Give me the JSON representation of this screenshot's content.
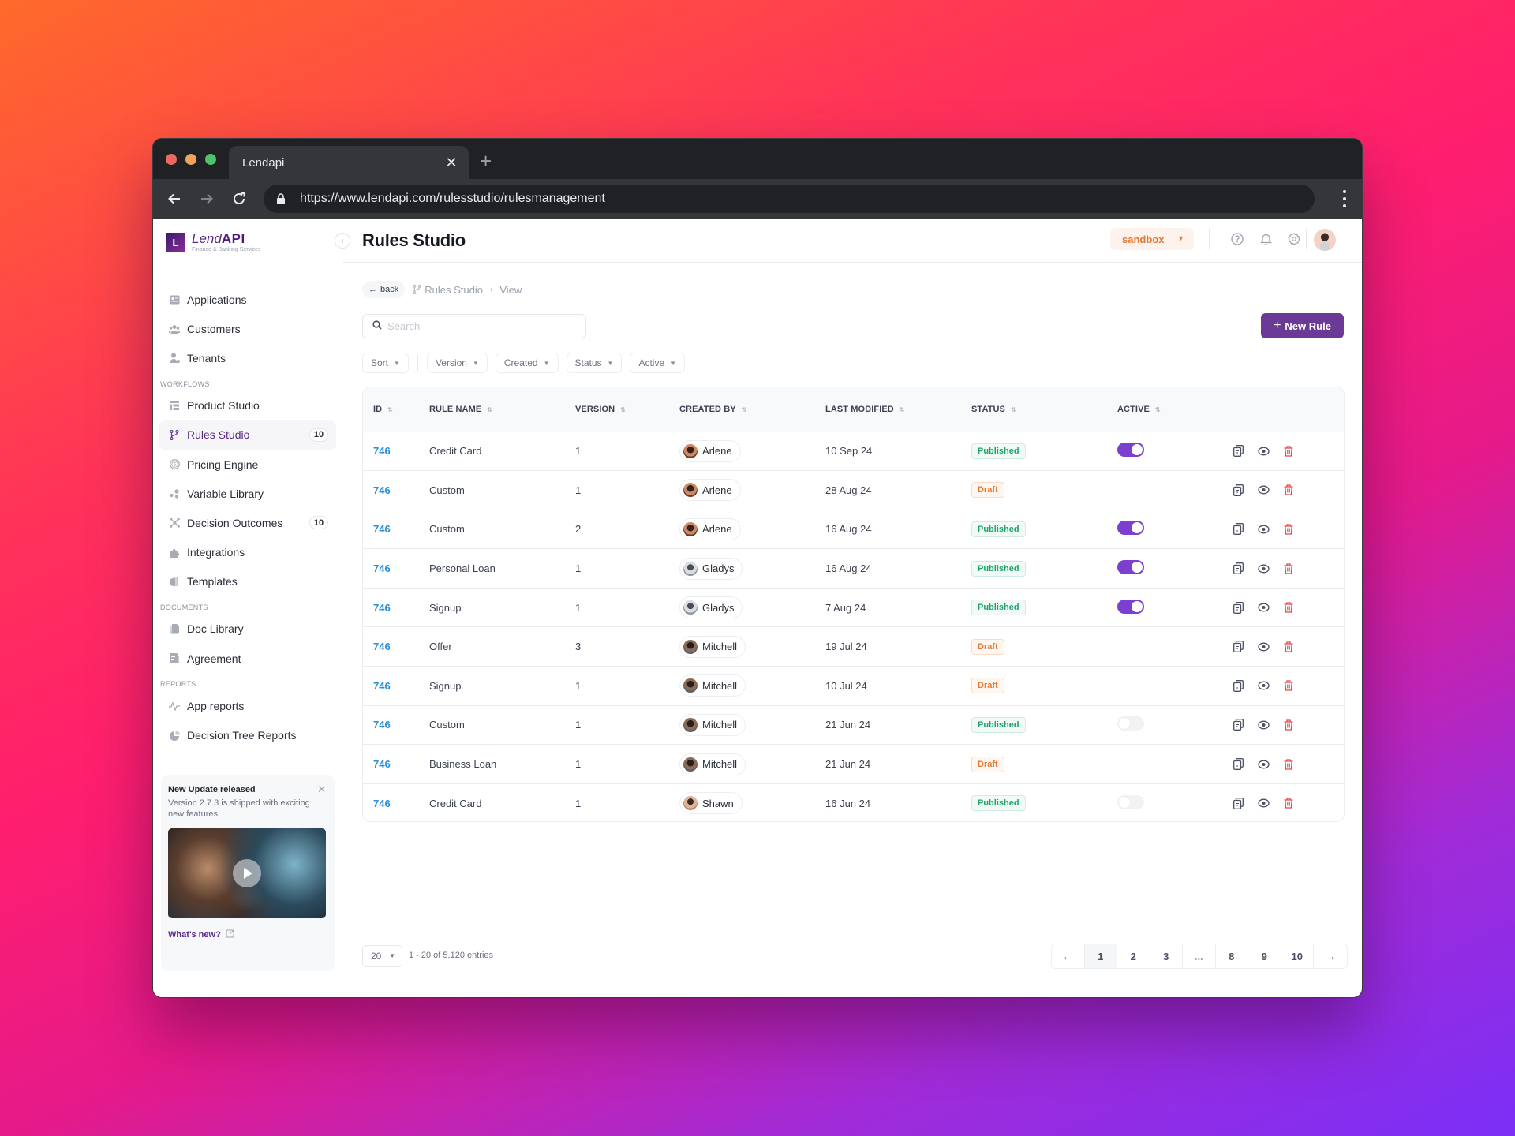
{
  "browser": {
    "tab_title": "Lendapi",
    "url": "https://www.lendapi.com/rulesstudio/rulesmanagement"
  },
  "brand": {
    "logo_letter": "L",
    "name_light": "Lend",
    "name_bold": "API",
    "tagline": "Finance & Banking Services",
    "accent_color": "#6a3a96"
  },
  "sidebar": {
    "items": [
      {
        "label": "Applications",
        "icon": "id-card-icon"
      },
      {
        "label": "Customers",
        "icon": "users-icon"
      },
      {
        "label": "Tenants",
        "icon": "user-star-icon"
      }
    ],
    "sections": [
      {
        "title": "WORKFLOWS",
        "items": [
          {
            "label": "Product Studio",
            "icon": "grid-icon"
          },
          {
            "label": "Rules Studio",
            "icon": "branch-icon",
            "badge": "10",
            "active": true
          },
          {
            "label": "Pricing Engine",
            "icon": "dollar-circle-icon"
          },
          {
            "label": "Variable Library",
            "icon": "dots-icon"
          },
          {
            "label": "Decision Outcomes",
            "icon": "network-icon",
            "badge": "10"
          },
          {
            "label": "Integrations",
            "icon": "puzzle-icon"
          },
          {
            "label": "Templates",
            "icon": "templates-icon"
          }
        ]
      },
      {
        "title": "DOCUMENTS",
        "items": [
          {
            "label": "Doc Library",
            "icon": "document-icon"
          },
          {
            "label": "Agreement",
            "icon": "agreement-icon"
          }
        ]
      },
      {
        "title": "REPORTS",
        "items": [
          {
            "label": "App reports",
            "icon": "activity-icon"
          },
          {
            "label": "Decision Tree Reports",
            "icon": "pie-icon"
          }
        ]
      }
    ],
    "update_card": {
      "title": "New Update released",
      "description": "Version 2.7.3 is shipped with  exciting new features",
      "link_label": "What's new?"
    }
  },
  "header": {
    "title": "Rules Studio",
    "environment": "sandbox"
  },
  "breadcrumb": {
    "back_label": "back",
    "items": [
      "Rules Studio",
      "View"
    ]
  },
  "toolbar": {
    "search_placeholder": "Search",
    "new_rule_label": "New Rule",
    "filters": [
      "Sort",
      "Version",
      "Created",
      "Status",
      "Active"
    ]
  },
  "table": {
    "columns": [
      "ID",
      "RULE NAME",
      "VERSION",
      "CREATED BY",
      "LAST MODIFIED",
      "STATUS",
      "ACTIVE"
    ],
    "rows": [
      {
        "id": "746",
        "name": "Credit Card",
        "version": "1",
        "created_by": "Arlene",
        "modified": "10 Sep 24",
        "status": "Published",
        "active": true
      },
      {
        "id": "746",
        "name": "Custom",
        "version": "1",
        "created_by": "Arlene",
        "modified": "28 Aug 24",
        "status": "Draft",
        "active": null
      },
      {
        "id": "746",
        "name": "Custom",
        "version": "2",
        "created_by": "Arlene",
        "modified": "16 Aug 24",
        "status": "Published",
        "active": true
      },
      {
        "id": "746",
        "name": "Personal Loan",
        "version": "1",
        "created_by": "Gladys",
        "modified": "16 Aug 24",
        "status": "Published",
        "active": true
      },
      {
        "id": "746",
        "name": "Signup",
        "version": "1",
        "created_by": "Gladys",
        "modified": "7 Aug 24",
        "status": "Published",
        "active": true
      },
      {
        "id": "746",
        "name": "Offer",
        "version": "3",
        "created_by": "Mitchell",
        "modified": "19 Jul 24",
        "status": "Draft",
        "active": null
      },
      {
        "id": "746",
        "name": "Signup",
        "version": "1",
        "created_by": "Mitchell",
        "modified": "10 Jul 24",
        "status": "Draft",
        "active": null
      },
      {
        "id": "746",
        "name": "Custom",
        "version": "1",
        "created_by": "Mitchell",
        "modified": "21 Jun 24",
        "status": "Published",
        "active": false
      },
      {
        "id": "746",
        "name": "Business Loan",
        "version": "1",
        "created_by": "Mitchell",
        "modified": "21 Jun 24",
        "status": "Draft",
        "active": null
      },
      {
        "id": "746",
        "name": "Credit Card",
        "version": "1",
        "created_by": "Shawn",
        "modified": "16 Jun 24",
        "status": "Published",
        "active": false
      }
    ]
  },
  "pagination": {
    "page_size": "20",
    "summary": "1 - 20 of 5,120 entries",
    "pages": [
      "1",
      "2",
      "3",
      "...",
      "8",
      "9",
      "10"
    ],
    "current_page": "1"
  },
  "colors": {
    "published": "#1fa36b",
    "draft": "#e07a35",
    "toggle_on": "#7d3fd0",
    "link": "#2b8fd6",
    "delete": "#e5484d"
  }
}
